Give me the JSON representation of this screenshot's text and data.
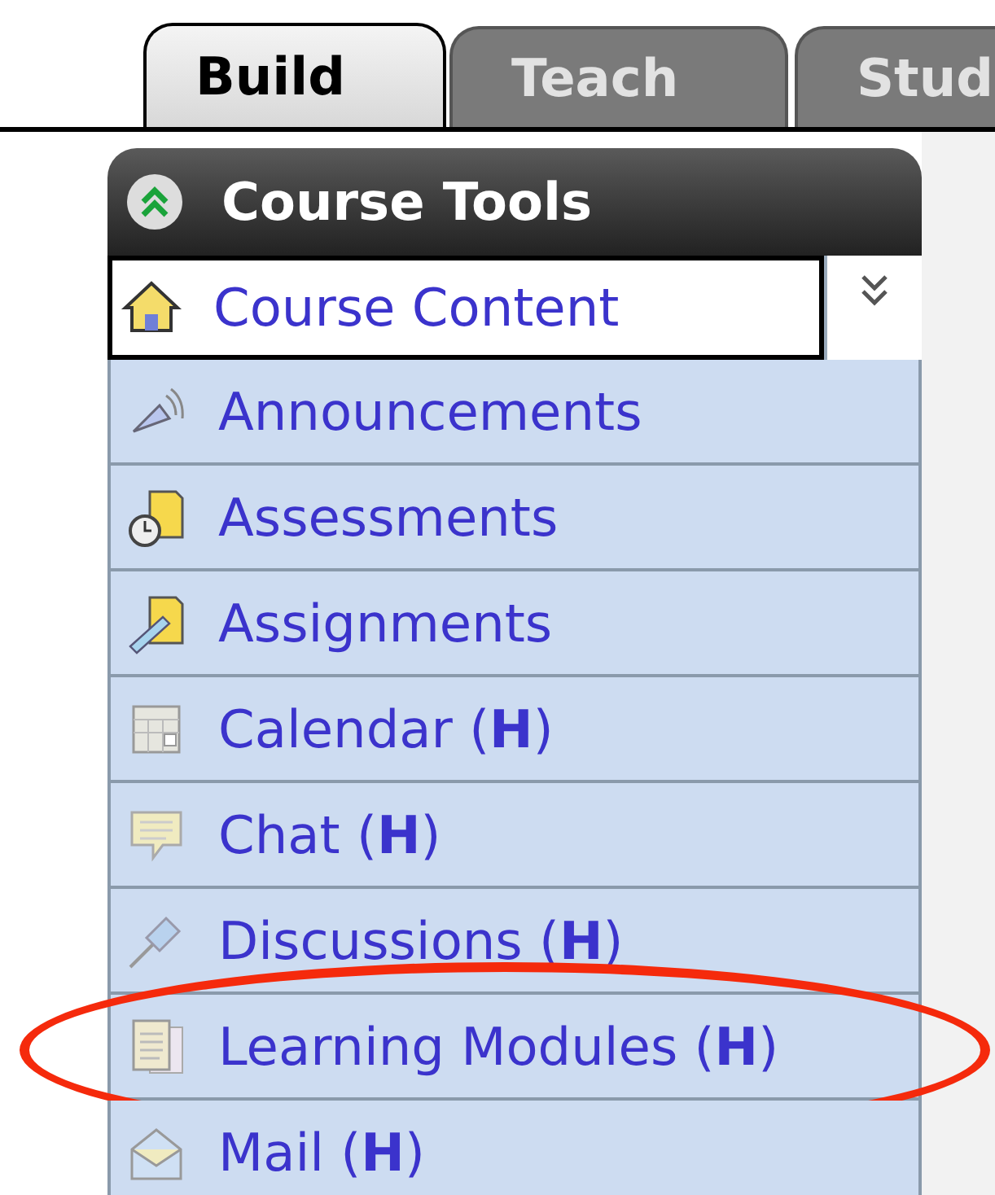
{
  "tabs": [
    {
      "label": "Build",
      "selected": true
    },
    {
      "label": "Teach",
      "selected": false
    },
    {
      "label": "Stud",
      "selected": false
    }
  ],
  "panel": {
    "title": "Course Tools",
    "expanded": true
  },
  "items": [
    {
      "label": "Course Content",
      "kind": "house",
      "selected": true,
      "circled": false
    },
    {
      "label": "Announcements",
      "kind": "megaphone",
      "selected": false,
      "circled": false
    },
    {
      "label": "Assessments",
      "kind": "stopwatch",
      "selected": false,
      "circled": false
    },
    {
      "label": "Assignments",
      "kind": "ruler",
      "selected": false,
      "circled": false
    },
    {
      "label": "Calendar (**H**)",
      "kind": "calendar",
      "selected": false,
      "circled": false
    },
    {
      "label": "Chat (**H**)",
      "kind": "chat",
      "selected": false,
      "circled": false
    },
    {
      "label": "Discussions (**H**)",
      "kind": "pin",
      "selected": false,
      "circled": false
    },
    {
      "label": "Learning Modules (**H**)",
      "kind": "pages",
      "selected": false,
      "circled": true
    },
    {
      "label": "Mail (**H**)",
      "kind": "envelope",
      "selected": false,
      "circled": false
    }
  ]
}
